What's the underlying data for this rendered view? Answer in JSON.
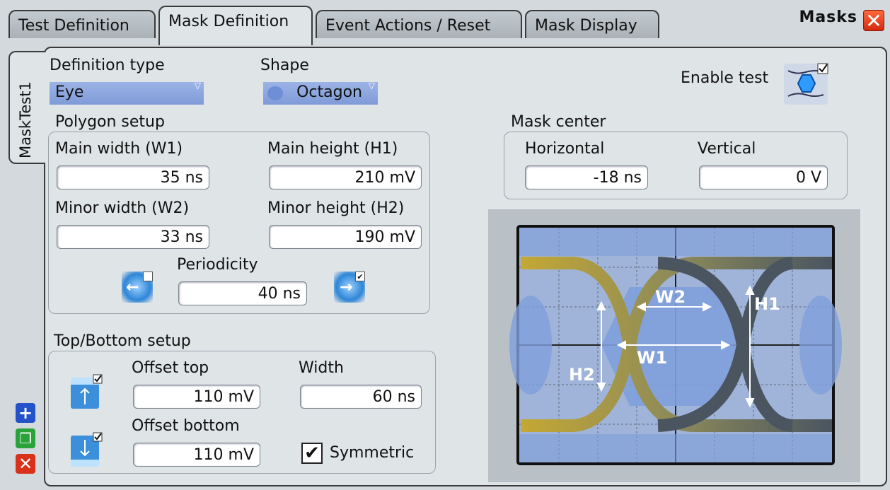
{
  "window": {
    "title": "Masks",
    "close_glyph": "✕",
    "tabs": [
      {
        "label": "Test Definition",
        "active": false
      },
      {
        "label": "Mask Definition",
        "active": true
      },
      {
        "label": "Event Actions / Reset",
        "active": false
      },
      {
        "label": "Mask Display",
        "active": false
      }
    ],
    "vertical_tab": "MaskTest1"
  },
  "definition": {
    "type_label": "Definition type",
    "type_value": "Eye",
    "shape_label": "Shape",
    "shape_value": "Octagon",
    "enable_test_label": "Enable test"
  },
  "polygon": {
    "title": "Polygon setup",
    "main_width_label": "Main width (W1)",
    "main_width_value": "35 ns",
    "main_height_label": "Main height (H1)",
    "main_height_value": "210 mV",
    "minor_width_label": "Minor width (W2)",
    "minor_width_value": "33 ns",
    "minor_height_label": "Minor height (H2)",
    "minor_height_value": "190 mV",
    "periodicity_label": "Periodicity",
    "periodicity_value": "40 ns"
  },
  "mask_center": {
    "title": "Mask center",
    "horizontal_label": "Horizontal",
    "horizontal_value": "-18 ns",
    "vertical_label": "Vertical",
    "vertical_value": "0 V"
  },
  "top_bottom": {
    "title": "Top/Bottom setup",
    "offset_top_label": "Offset top",
    "offset_top_value": "110 mV",
    "width_label": "Width",
    "width_value": "60 ns",
    "offset_bottom_label": "Offset bottom",
    "offset_bottom_value": "110 mV",
    "symmetric_label": "Symmetric",
    "symmetric_checked": true,
    "check_glyph": "✔"
  },
  "side_buttons": {
    "add_glyph": "+",
    "copy_glyph": "❐",
    "remove_glyph": "✕"
  },
  "diagram": {
    "labels": {
      "w1": "W1",
      "w2": "W2",
      "h1": "H1",
      "h2": "H2"
    }
  },
  "colors": {
    "accent": "#2e86d6",
    "close": "#d42a10",
    "eye_left": "#b59a2e",
    "eye_right": "#4b5560",
    "mask": "#7f9fdc"
  }
}
